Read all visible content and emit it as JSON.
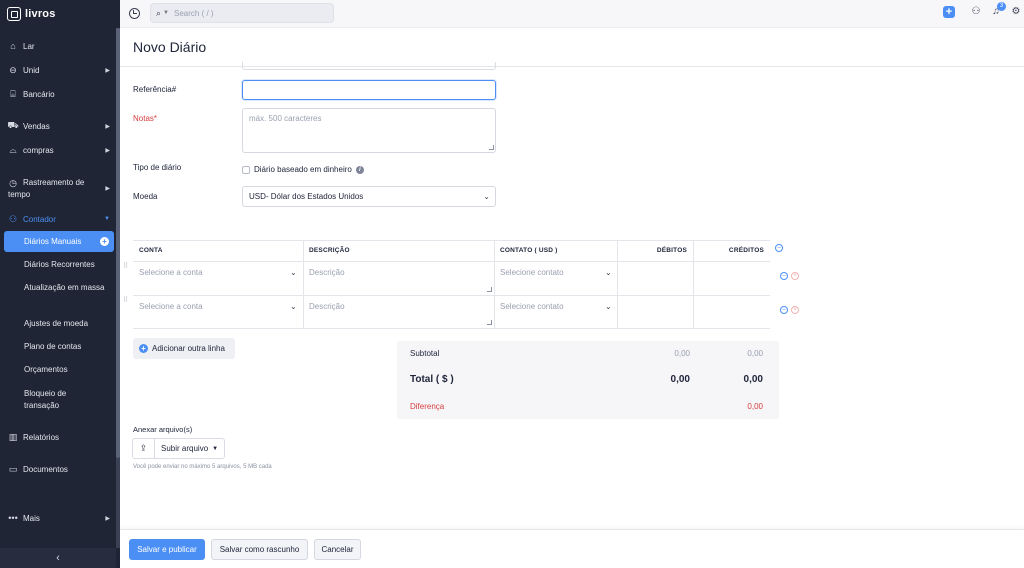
{
  "brand": {
    "name": "livros"
  },
  "sidebar": {
    "items": [
      {
        "label": "Lar",
        "icon": "home-icon"
      },
      {
        "label": "Unid",
        "icon": "basket-icon"
      },
      {
        "label": "Bancário",
        "icon": "bank-icon"
      },
      {
        "label": "Vendas",
        "icon": "cart-icon"
      },
      {
        "label": "compras",
        "icon": "bag-icon"
      },
      {
        "label": "Rastreamento de tempo",
        "icon": "clock-icon"
      },
      {
        "label": "Contador",
        "icon": "accountant-icon"
      },
      {
        "label": "Relatórios",
        "icon": "chart-icon"
      },
      {
        "label": "Documentos",
        "icon": "folder-icon"
      },
      {
        "label": "Mais",
        "icon": "more-icon"
      }
    ],
    "sub_items": [
      {
        "label": "Diários Manuais"
      },
      {
        "label": "Diários Recorrentes"
      },
      {
        "label": "Atualização em massa"
      },
      {
        "label": "Ajustes de moeda"
      },
      {
        "label": "Plano de contas"
      },
      {
        "label": "Orçamentos"
      },
      {
        "label": "Bloqueio de transação"
      }
    ]
  },
  "topbar": {
    "search_placeholder": "Search ( / )",
    "notification_count": "3"
  },
  "page": {
    "title": "Novo Diário"
  },
  "form": {
    "reference_label": "Referência#",
    "reference_value": "",
    "notes_label": "Notas*",
    "notes_placeholder": "máx. 500 caracteres",
    "journal_type_label": "Tipo de diário",
    "cash_based_label": "Diário baseado em dinheiro",
    "currency_label": "Moeda",
    "currency_value": "USD- Dólar dos Estados Unidos"
  },
  "table": {
    "headers": [
      "CONTA",
      "DESCRIÇÃO",
      "CONTATO ( USD )",
      "DÉBITOS",
      "CRÉDITOS"
    ],
    "rows": [
      {
        "account": "Selecione a conta",
        "description": "Descrição",
        "contact": "Selecione contato"
      },
      {
        "account": "Selecione a conta",
        "description": "Descrição",
        "contact": "Selecione contato"
      }
    ],
    "add_row_label": "Adicionar outra linha"
  },
  "totals": {
    "subtotal_label": "Subtotal",
    "subtotal_debit": "0,00",
    "subtotal_credit": "0,00",
    "total_label": "Total ( $ )",
    "total_debit": "0,00",
    "total_credit": "0,00",
    "difference_label": "Diferença",
    "difference_value": "0,00"
  },
  "attachments": {
    "label": "Anexar arquivo(s)",
    "upload_label": "Subir arquivo",
    "hint": "Você pode enviar no máximo 5 arquivos, 5 MB cada"
  },
  "footer": {
    "save_publish": "Salvar e publicar",
    "save_draft": "Salvar como rascunho",
    "cancel": "Cancelar"
  },
  "colors": {
    "accent": "#4b8ff4",
    "sidebar_bg": "#1f2535",
    "required": "#d63e3e"
  }
}
